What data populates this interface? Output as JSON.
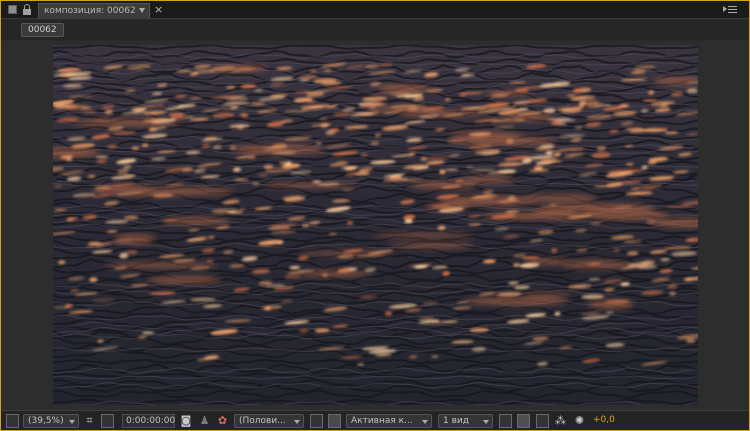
{
  "tab": {
    "title": "композиция: 00062",
    "close_glyph": "×"
  },
  "breadcrumb": {
    "label": "00062"
  },
  "viewer": {
    "content": "ocean-waves-at-sunset"
  },
  "toolbar": {
    "zoom": "(39,5%)",
    "timecode": "0:00:00:00",
    "resolution": "(Полови...",
    "view": "Активная к...",
    "layout": "1 вид",
    "exposure": "+0,0"
  },
  "colors": {
    "panel_border": "#d7a21a",
    "exposure_text": "#e3a51c"
  }
}
